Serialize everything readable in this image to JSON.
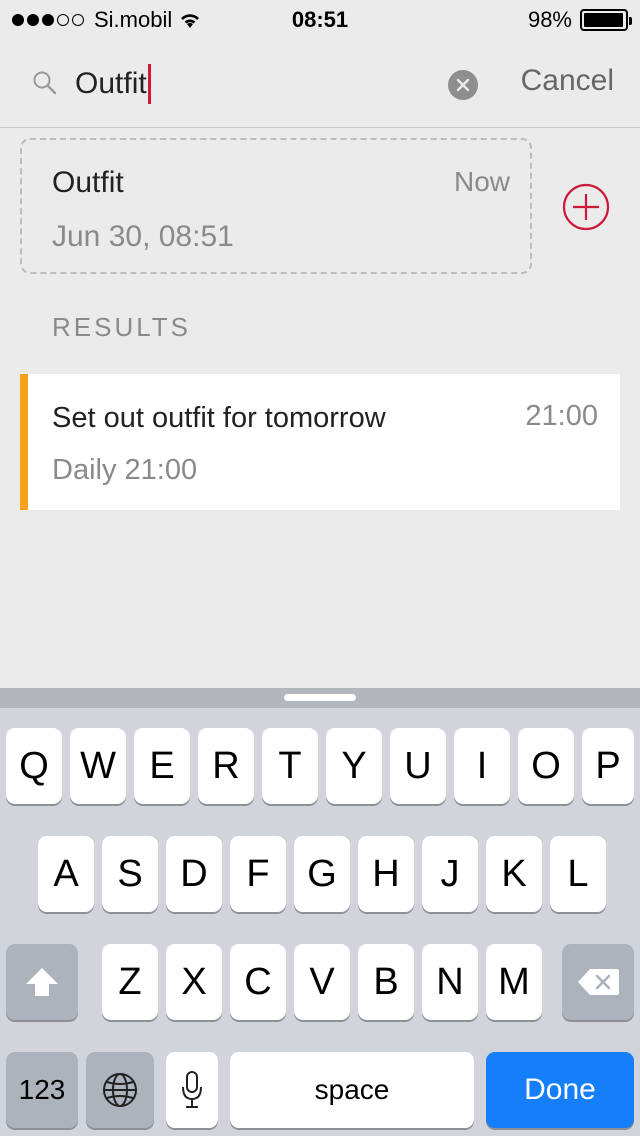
{
  "status_bar": {
    "carrier": "Si.mobil",
    "time": "08:51",
    "battery_percent": "98%",
    "battery_level": 0.98
  },
  "search": {
    "query": "Outfit",
    "cancel_label": "Cancel"
  },
  "new_item": {
    "title": "Outfit",
    "when": "Now",
    "date": "Jun 30, 08:51"
  },
  "results": {
    "header": "RESULTS",
    "items": [
      {
        "title": "Set out outfit for tomorrow",
        "time": "21:00",
        "subtitle": "Daily 21:00",
        "accent_color": "#f7a21b"
      }
    ]
  },
  "keyboard": {
    "row1": [
      "Q",
      "W",
      "E",
      "R",
      "T",
      "Y",
      "U",
      "I",
      "O",
      "P"
    ],
    "row2": [
      "A",
      "S",
      "D",
      "F",
      "G",
      "H",
      "J",
      "K",
      "L"
    ],
    "row3": [
      "Z",
      "X",
      "C",
      "V",
      "B",
      "N",
      "M"
    ],
    "numbers_label": "123",
    "space_label": "space",
    "done_label": "Done",
    "icons": [
      "shift-icon",
      "backspace-icon",
      "globe-icon",
      "microphone-icon"
    ]
  },
  "colors": {
    "accent_red": "#cc1a3a",
    "done_blue": "#147efb"
  }
}
